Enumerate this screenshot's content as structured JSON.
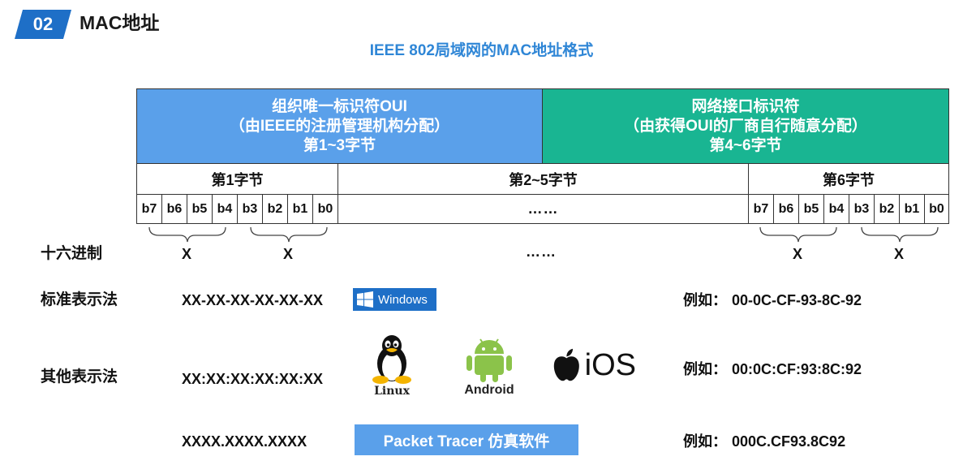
{
  "header": {
    "section_number": "02",
    "section_title": "MAC地址",
    "diagram_title": "IEEE 802局域网的MAC地址格式"
  },
  "format": {
    "oui": {
      "line1": "组织唯一标识符OUI",
      "line2": "（由IEEE的注册管理机构分配）",
      "line3": "第1~3字节"
    },
    "nic": {
      "line1": "网络接口标识符",
      "line2": "（由获得OUI的厂商自行随意分配）",
      "line3": "第4~6字节"
    },
    "bytes": {
      "first": "第1字节",
      "middle": "第2~5字节",
      "last": "第6字节"
    },
    "bits_first": [
      "b7",
      "b6",
      "b5",
      "b4",
      "b3",
      "b2",
      "b1",
      "b0"
    ],
    "bits_middle": "……",
    "bits_last": [
      "b7",
      "b6",
      "b5",
      "b4",
      "b3",
      "b2",
      "b1",
      "b0"
    ]
  },
  "hex_row": {
    "label": "十六进制",
    "symbol": "X",
    "ellipsis": "……"
  },
  "standard": {
    "label": "标准表示法",
    "format": "XX-XX-XX-XX-XX-XX",
    "platform": "Windows",
    "example_label": "例如：",
    "example_value": "00-0C-CF-93-8C-92"
  },
  "other": {
    "label": "其他表示法",
    "format": "XX:XX:XX:XX:XX:XX",
    "platforms": [
      "Linux",
      "Android",
      "iOS"
    ],
    "example_label": "例如：",
    "example_value": "00:0C:CF:93:8C:92"
  },
  "packet_tracer": {
    "format": "XXXX.XXXX.XXXX",
    "software": "Packet Tracer 仿真软件",
    "example_label": "例如：",
    "example_value": "000C.CF93.8C92"
  },
  "colors": {
    "oui": "#5aa0ea",
    "nic": "#19b592",
    "title_blue": "#2f86d6",
    "badge_blue": "#1e6fc7",
    "android_green": "#8bc34a"
  }
}
